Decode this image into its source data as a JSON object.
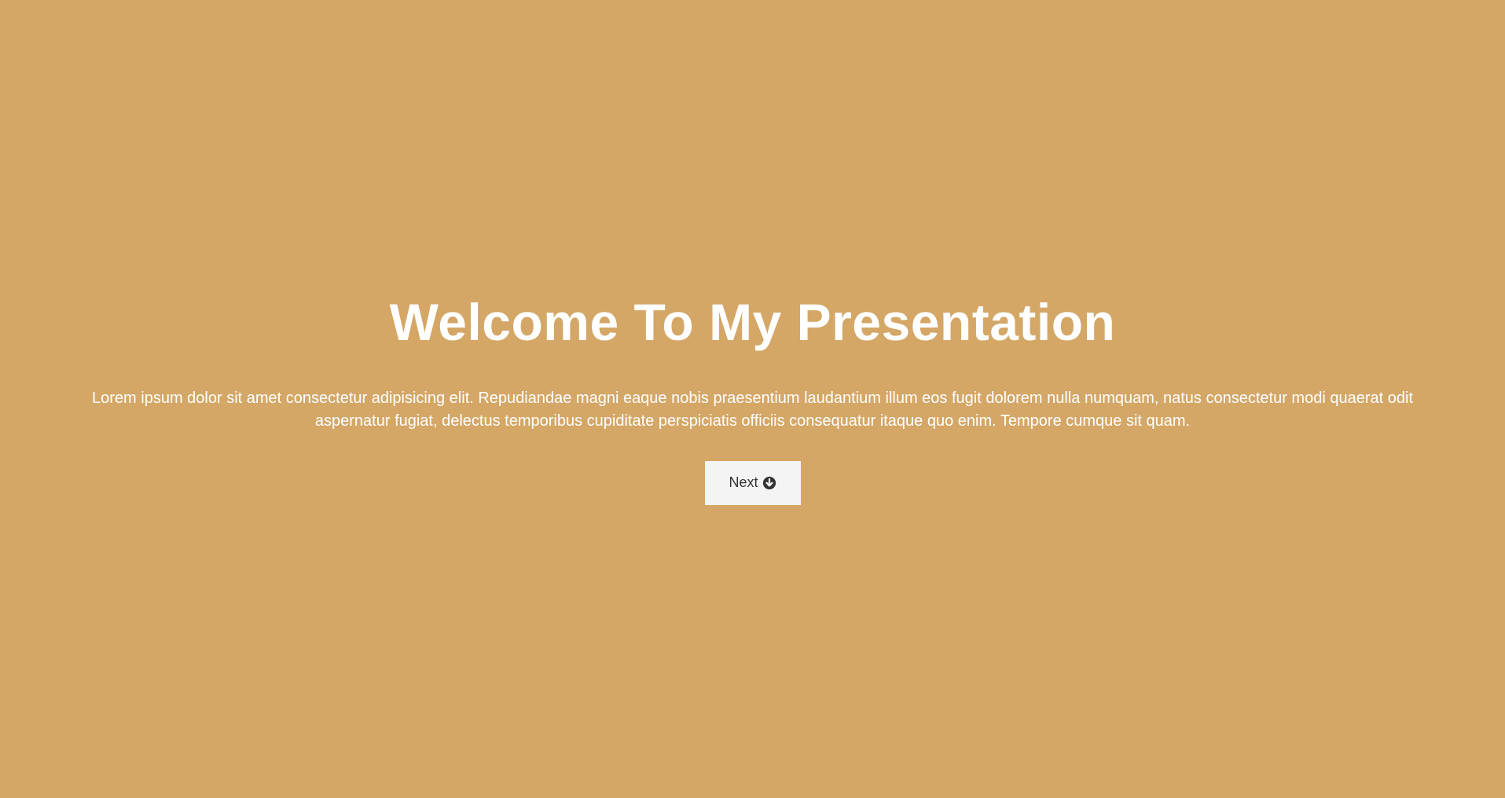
{
  "hero": {
    "title": "Welcome To My Presentation",
    "description": "Lorem ipsum dolor sit amet consectetur adipisicing elit. Repudiandae magni eaque nobis praesentium laudantium illum eos fugit dolorem nulla numquam, natus consectetur modi quaerat odit aspernatur fugiat, delectus temporibus cupiditate perspiciatis officiis consequatur itaque quo enim. Tempore cumque sit quam.",
    "next_button": {
      "label": "Next",
      "icon": "arrow-circle-down-icon"
    }
  },
  "colors": {
    "background": "#d4a767",
    "text": "#ffffff",
    "button_background": "#f4f4f4",
    "button_text": "#333333"
  }
}
